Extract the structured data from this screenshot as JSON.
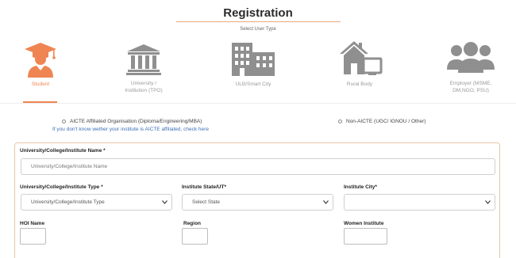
{
  "page": {
    "title": "Registration",
    "subtitle": "Select User Type"
  },
  "user_types": [
    {
      "label": "Student",
      "icon": "graduate-icon",
      "active": true
    },
    {
      "label_line1": "University /",
      "label_line2": "Institution (TPO)",
      "icon": "institution-building-icon",
      "active": false
    },
    {
      "label": "ULB/Smart City",
      "icon": "city-buildings-icon",
      "active": false
    },
    {
      "label": "Rural Body",
      "icon": "rural-house-icon",
      "active": false
    },
    {
      "label_line1": "Employer (MSME,",
      "label_line2": "DM,NGO, PSU)",
      "icon": "people-group-icon",
      "active": false
    }
  ],
  "affiliation": {
    "option_aicte": "AICTE Affiliated Organisation (Diploma/Engineering/MBA)",
    "option_non_aicte": "Non-AICTE (UGC/ IGNOU / Other)",
    "help_link": "If you don't know wether your institute is AICTE affiliated, check here"
  },
  "form": {
    "name_label": "University/College/Institute Name *",
    "name_placeholder": "University/College/Institute Name",
    "type_label": "University/College/Institute Type *",
    "type_value": "University/College/Institute Type",
    "state_label": "Institute State/UT*",
    "state_value": "Select State",
    "city_label": "Institute City*",
    "city_value": "",
    "hoi_label": "HOI Name",
    "region_label": "Region",
    "women_label": "Women Institute"
  },
  "colors": {
    "accent": "#ef8552",
    "icon_gray": "#8f8f8f",
    "link": "#3d6fb6",
    "card_border": "#e9c7a8"
  }
}
